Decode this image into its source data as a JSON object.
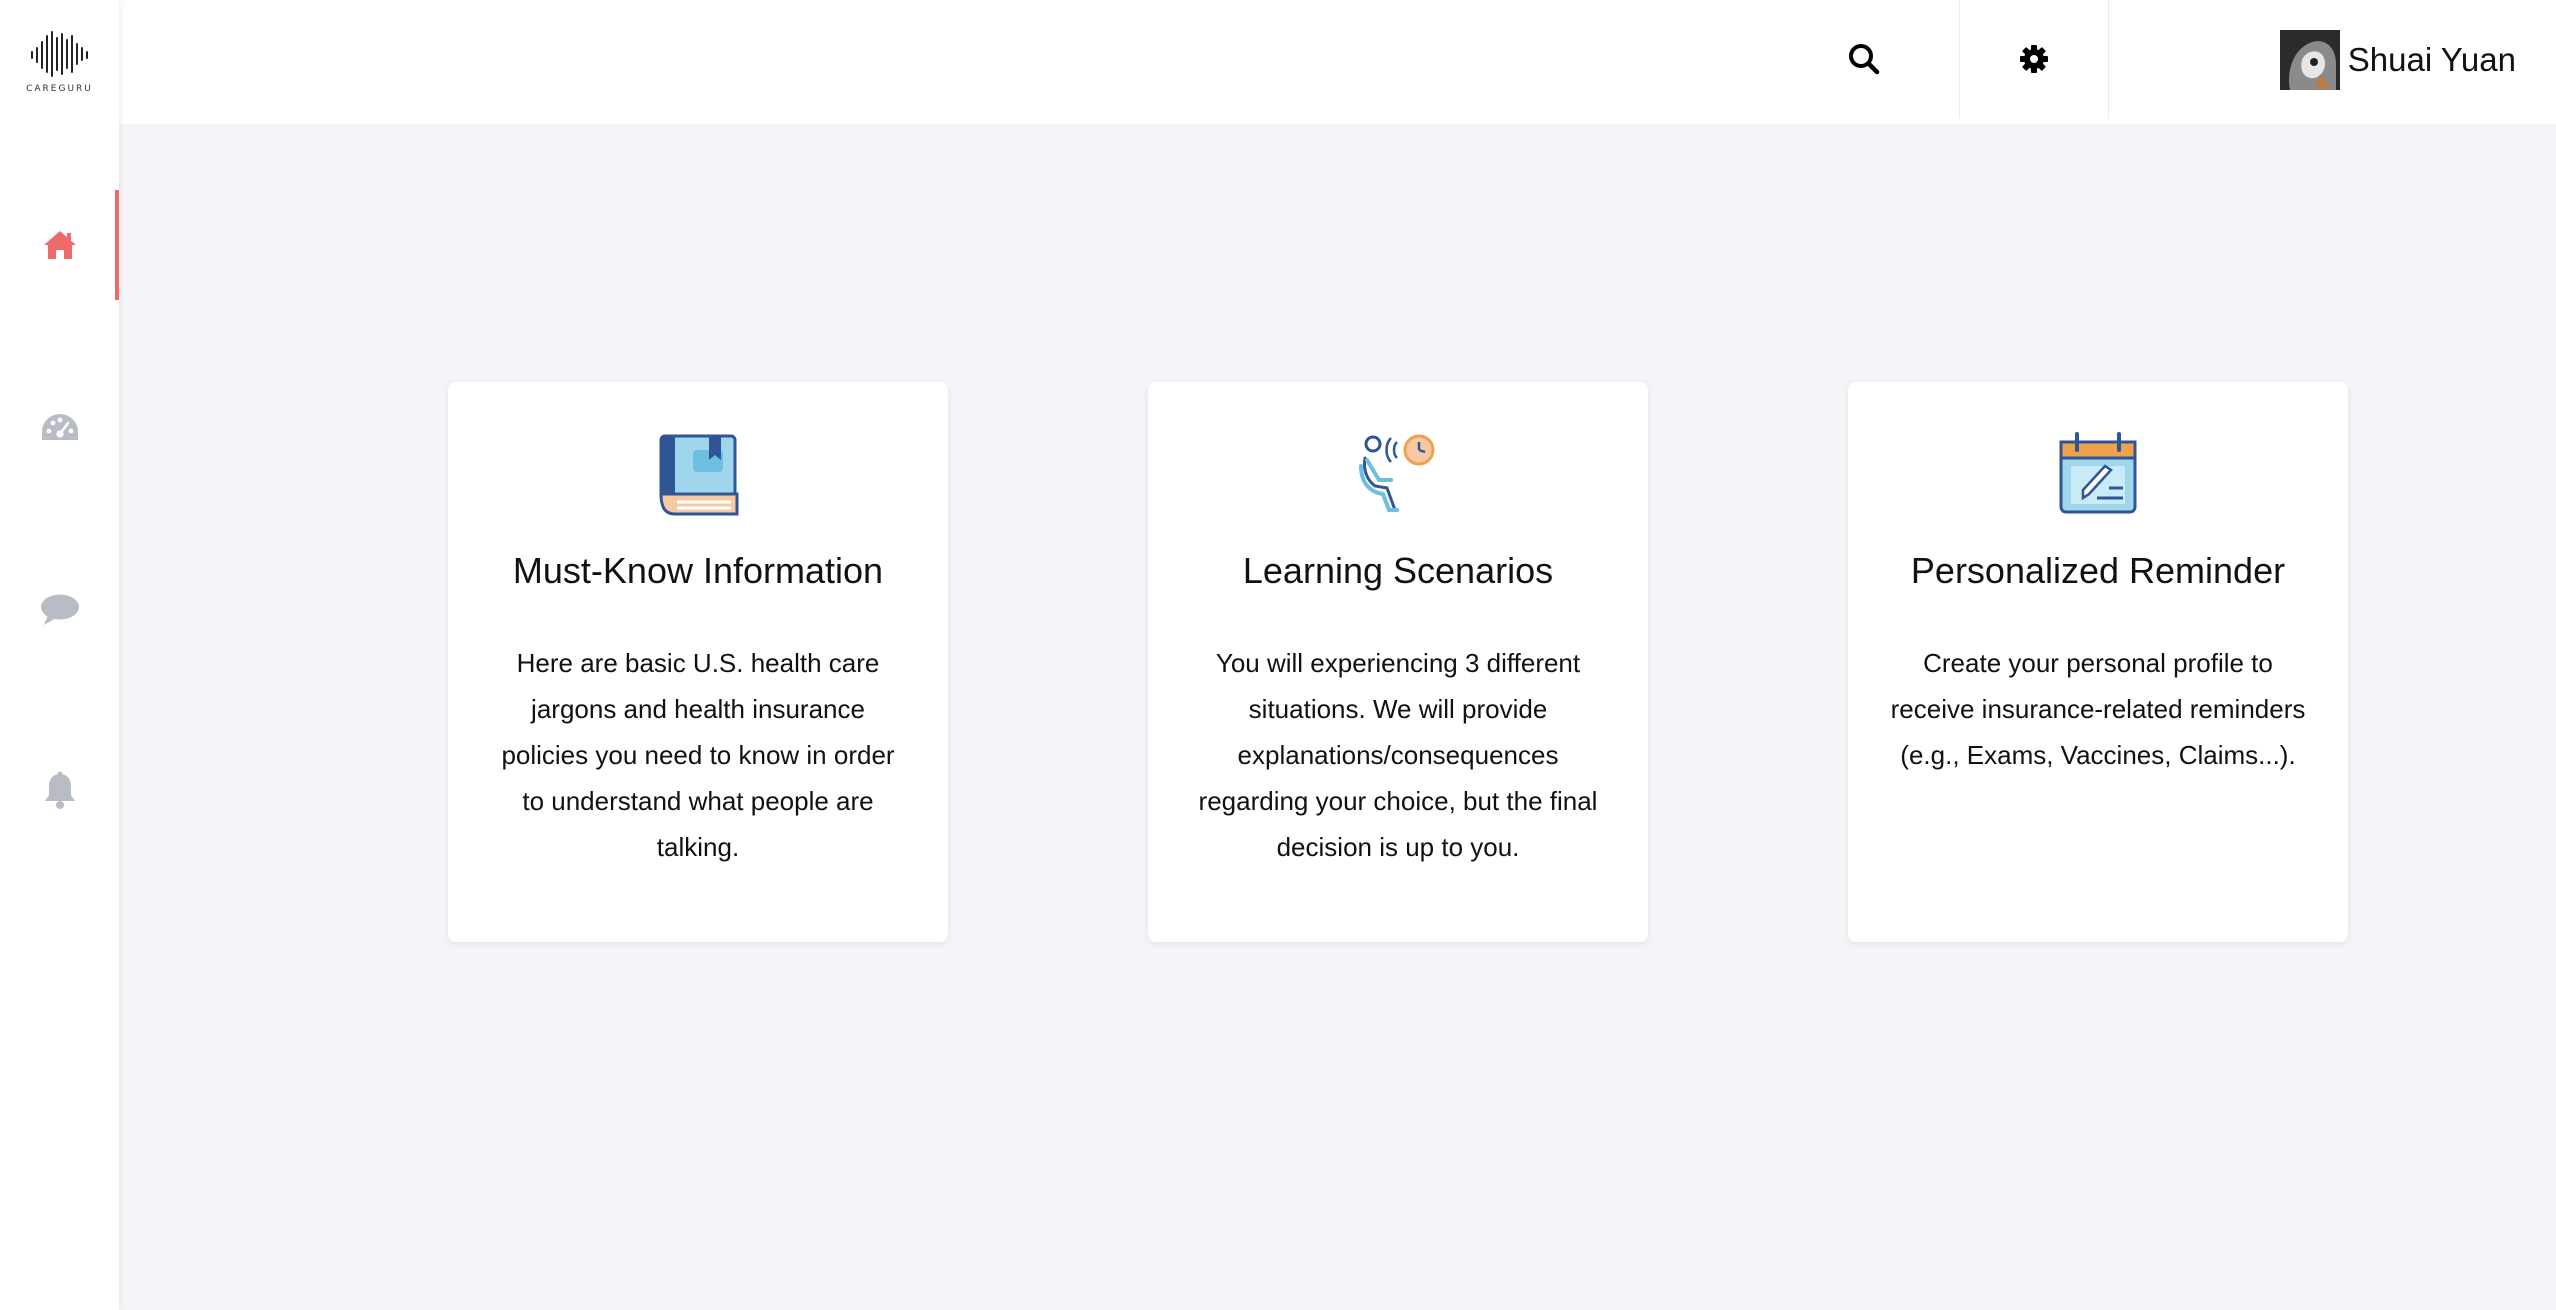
{
  "app": {
    "logo_text": "CAREGURU"
  },
  "sidebar": {
    "items": [
      {
        "name": "home",
        "icon": "home-icon",
        "active": true
      },
      {
        "name": "dashboard",
        "icon": "speedometer-icon",
        "active": false
      },
      {
        "name": "messages",
        "icon": "chat-bubble-icon",
        "active": false
      },
      {
        "name": "notifications",
        "icon": "bell-icon",
        "active": false
      }
    ]
  },
  "topbar": {
    "search_icon": "search-icon",
    "settings_icon": "gear-icon",
    "user_name": "Shuai Yuan"
  },
  "cards": [
    {
      "title": "Must-Know Information",
      "description": "Here are basic U.S. health care jargons and health insurance policies you need to know in order to understand what people are talking.",
      "icon": "book-icon"
    },
    {
      "title": "Learning Scenarios",
      "description": "You will experiencing 3 different situations. We will provide explanations/consequences regarding your choice, but the final decision is up to you.",
      "icon": "waiting-room-icon"
    },
    {
      "title": "Personalized Reminder",
      "description": "Create your personal profile to receive insurance-related reminders (e.g., Exams, Vaccines, Claims...).",
      "icon": "calendar-icon"
    }
  ],
  "colors": {
    "accent": "#ef6b6b",
    "nav_inactive": "#b8bcc4",
    "background": "#f4f5f8",
    "card_blue": "#2f5597",
    "card_light_blue": "#9fd6ec",
    "card_orange": "#f0a14b",
    "card_peach": "#f7c9a3"
  }
}
